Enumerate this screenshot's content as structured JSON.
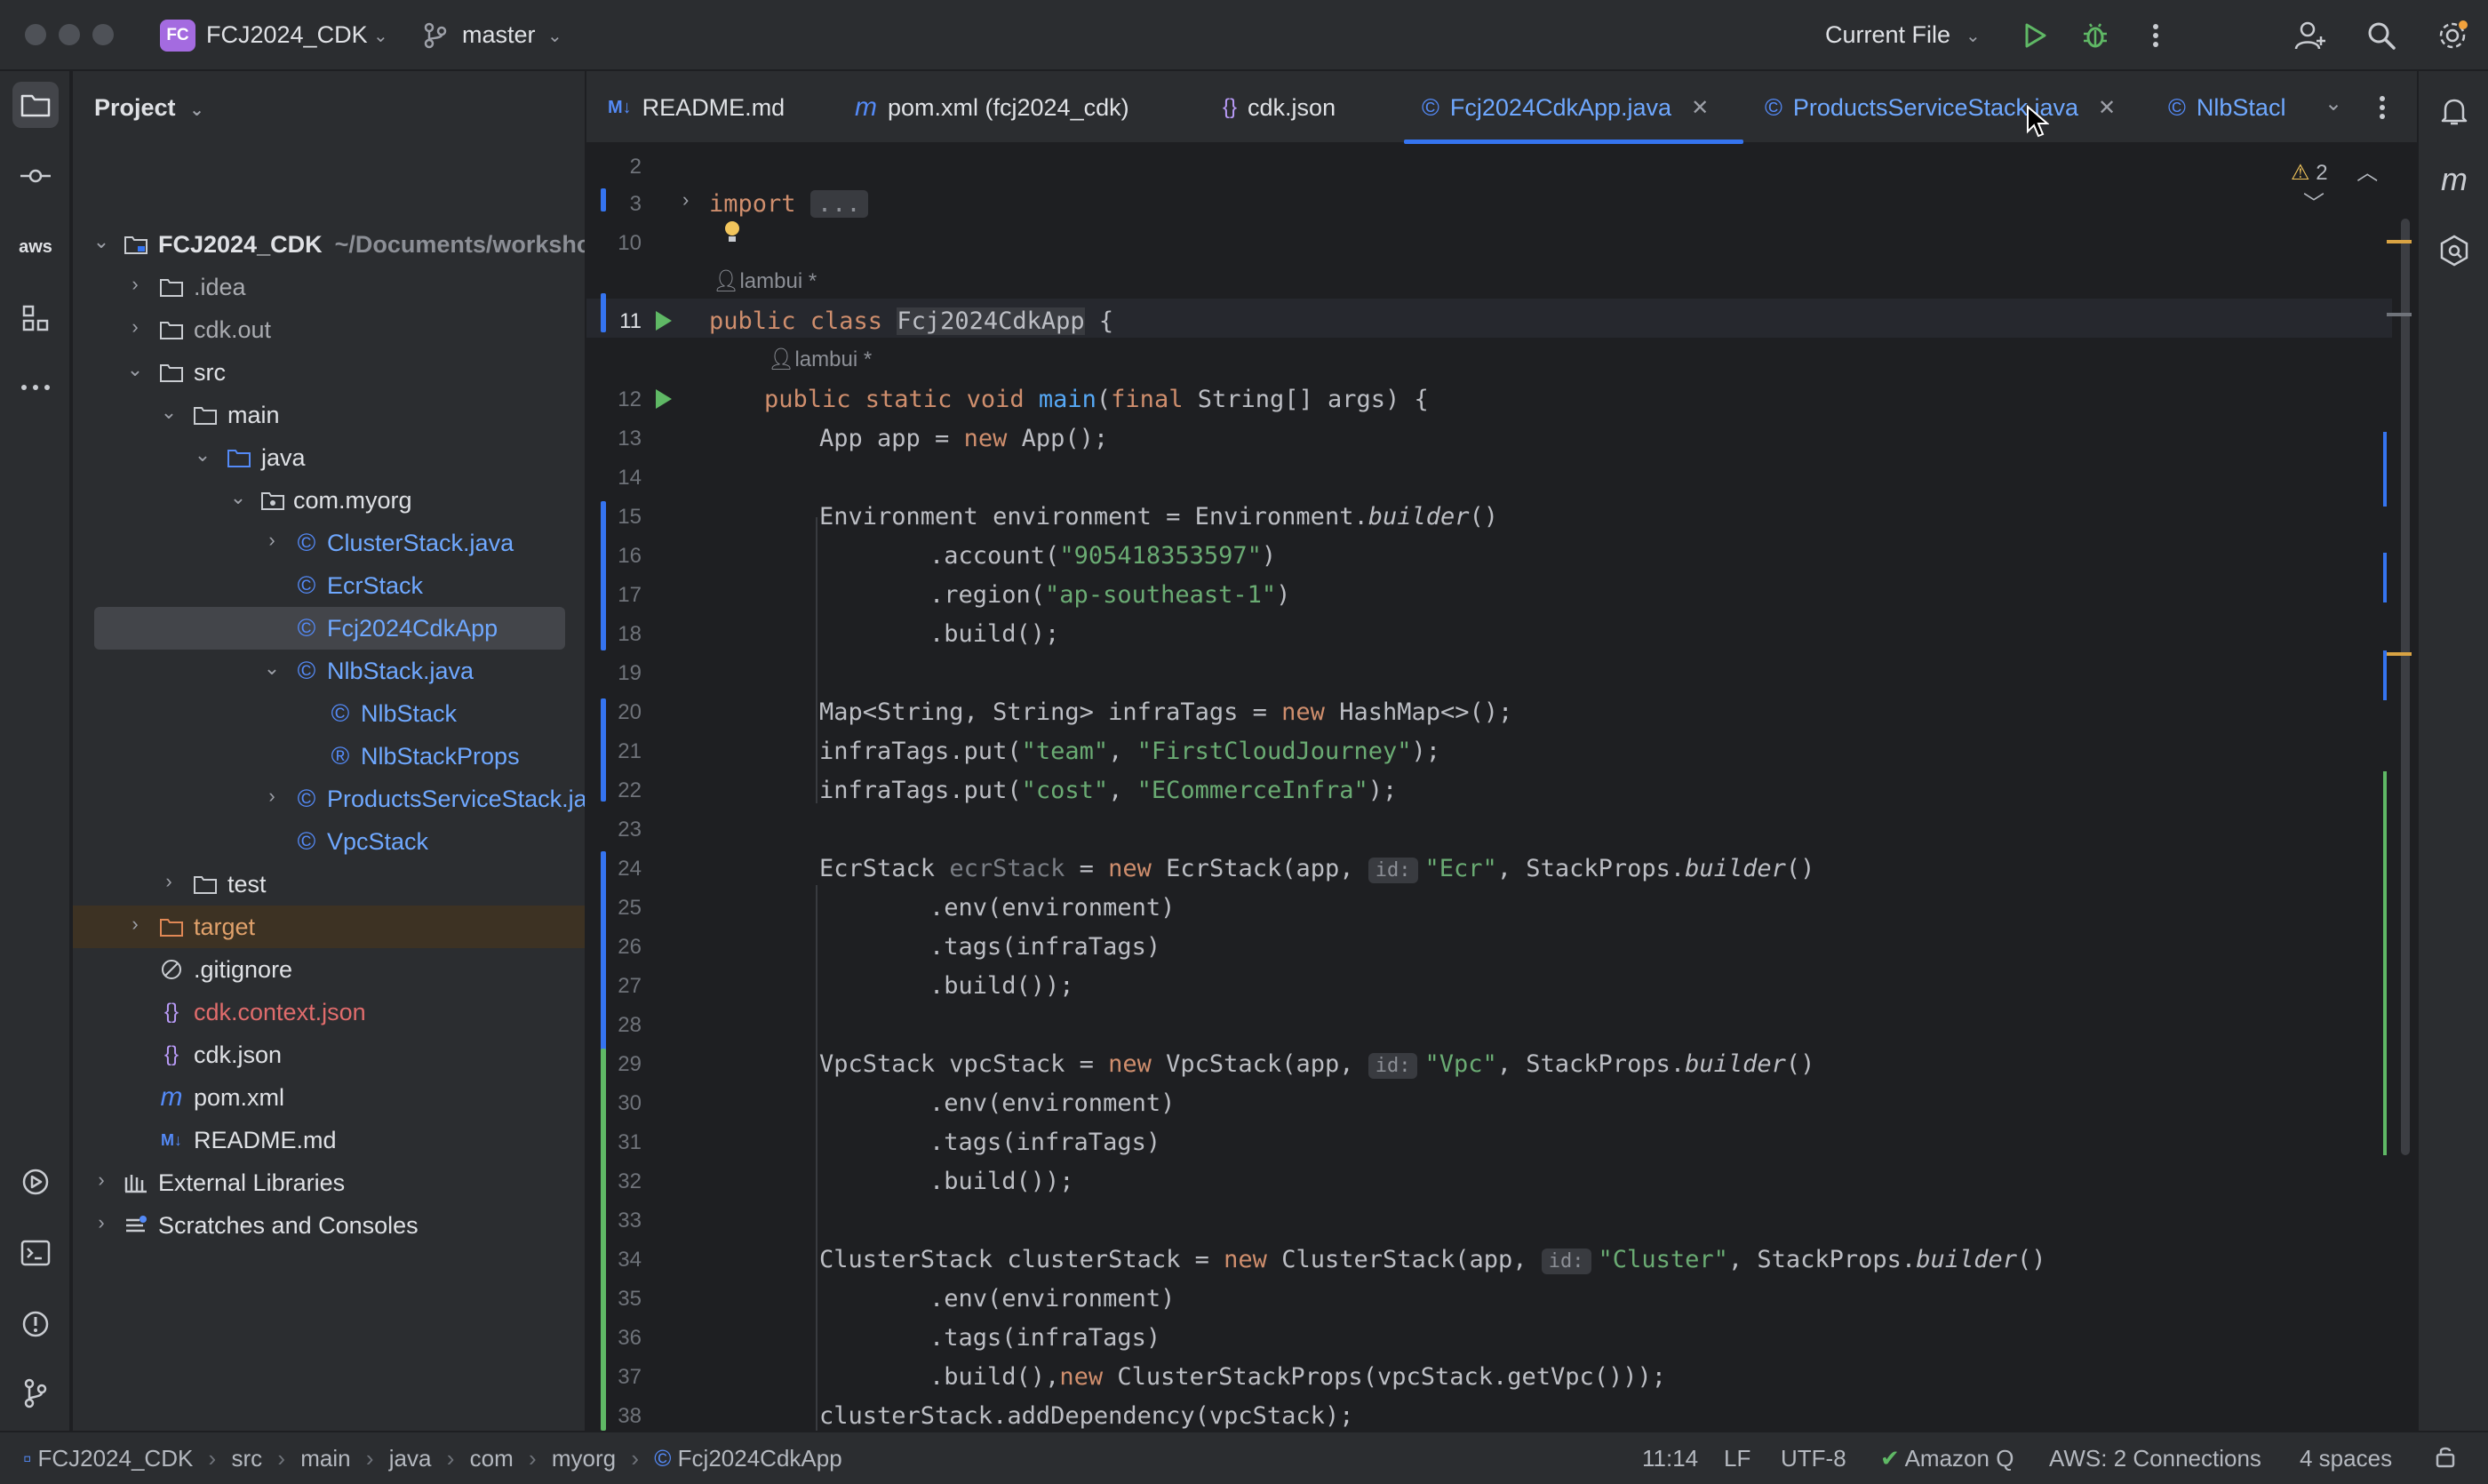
{
  "titlebar": {
    "project_badge": "FC",
    "project_name": "FCJ2024_CDK",
    "branch": "master",
    "run_config": "Current File"
  },
  "sidebar": {
    "title": "Project",
    "tree": [
      {
        "label": "FCJ2024_CDK",
        "hint": "~/Documents/worksho",
        "bold": true
      },
      {
        "label": ".idea"
      },
      {
        "label": "cdk.out"
      },
      {
        "label": "src"
      },
      {
        "label": "main"
      },
      {
        "label": "java"
      },
      {
        "label": "com.myorg"
      },
      {
        "label": "ClusterStack.java"
      },
      {
        "label": "EcrStack"
      },
      {
        "label": "Fcj2024CdkApp"
      },
      {
        "label": "NlbStack.java"
      },
      {
        "label": "NlbStack"
      },
      {
        "label": "NlbStackProps"
      },
      {
        "label": "ProductsServiceStack.ja"
      },
      {
        "label": "VpcStack"
      },
      {
        "label": "test"
      },
      {
        "label": "target"
      },
      {
        "label": ".gitignore"
      },
      {
        "label": "cdk.context.json"
      },
      {
        "label": "cdk.json"
      },
      {
        "label": "pom.xml"
      },
      {
        "label": "README.md"
      },
      {
        "label": "External Libraries"
      },
      {
        "label": "Scratches and Consoles"
      }
    ]
  },
  "tabs": [
    {
      "icon": "M↓",
      "label": "README.md"
    },
    {
      "icon": "m",
      "label": "pom.xml (fcj2024_cdk)"
    },
    {
      "icon": "{}",
      "label": "cdk.json"
    },
    {
      "icon": "©",
      "label": "Fcj2024CdkApp.java",
      "active": true
    },
    {
      "icon": "©",
      "label": "ProductsServiceStack.java"
    },
    {
      "icon": "©",
      "label": "NlbStacl"
    }
  ],
  "editor": {
    "author": "lambui *",
    "warnings": "2",
    "line_numbers": [
      "2",
      "3",
      "10",
      "11",
      "12",
      "13",
      "14",
      "15",
      "16",
      "17",
      "18",
      "19",
      "20",
      "21",
      "22",
      "23",
      "24",
      "25",
      "26",
      "27",
      "28",
      "29",
      "30",
      "31",
      "32",
      "33",
      "34",
      "35",
      "36",
      "37",
      "38"
    ],
    "code": {
      "l3_kw": "import",
      "l3_fold": "...",
      "l11_kw": "public class",
      "l11_cls": "Fcj2024CdkApp",
      "l11_rest": " {",
      "l12_kw": "public static void",
      "l12_fn": "main",
      "l12_kw2": "final",
      "l12_rest": "String[] args) {",
      "l13_a": "App app = ",
      "l13_kw": "new",
      "l13_b": " App();",
      "l15_a": "Environment environment = Environment.",
      "l15_it": "builder",
      "l15_b": "()",
      "l16_a": ".account(",
      "l16_str": "\"905418353597\"",
      "l16_b": ")",
      "l17_a": ".region(",
      "l17_str": "\"ap-southeast-1\"",
      "l17_b": ")",
      "l18": ".build();",
      "l20_a": "Map<String, String> infraTags = ",
      "l20_kw": "new",
      "l20_b": " HashMap<>();",
      "l21_a": "infraTags.put(",
      "l21_s1": "\"team\"",
      "l21_s2": "\"FirstCloudJourney\"",
      "l22_a": "infraTags.put(",
      "l22_s1": "\"cost\"",
      "l22_s2": "\"ECommerceInfra\"",
      "l24_a": "EcrStack ",
      "l24_var": "ecrStack",
      "l24_kw": "new",
      "l24_b": " EcrStack(app, ",
      "id_hint": "id:",
      "l24_str": "\"Ecr\"",
      "l24_c": ", StackProps.",
      "builder": "builder",
      "l25": ".env(environment)",
      "l26": ".tags(infraTags)",
      "l27": ".build());",
      "l29_a": "VpcStack vpcStack = ",
      "l29_b": " VpcStack(app, ",
      "l29_str": "\"Vpc\"",
      "l34_a": "ClusterStack clusterStack = ",
      "l34_b": " ClusterStack(app, ",
      "l34_str": "\"Cluster\"",
      "l37_a": ".build(),",
      "l37_b": " ClusterStackProps(vpcStack.getVpc()));",
      "l38": "clusterStack.addDependency(vpcStack);"
    }
  },
  "breadcrumb": [
    "FCJ2024_CDK",
    "src",
    "main",
    "java",
    "com",
    "myorg",
    "Fcj2024CdkApp"
  ],
  "status": {
    "position": "11:14",
    "line_ending": "LF",
    "encoding": "UTF-8",
    "amazon_q": "Amazon Q",
    "aws": "AWS: 2 Connections",
    "indent": "4 spaces"
  },
  "colors": {
    "keyword": "#cf8e6d",
    "string": "#6aab73",
    "function": "#56a8f5",
    "accent": "#3574f0"
  }
}
